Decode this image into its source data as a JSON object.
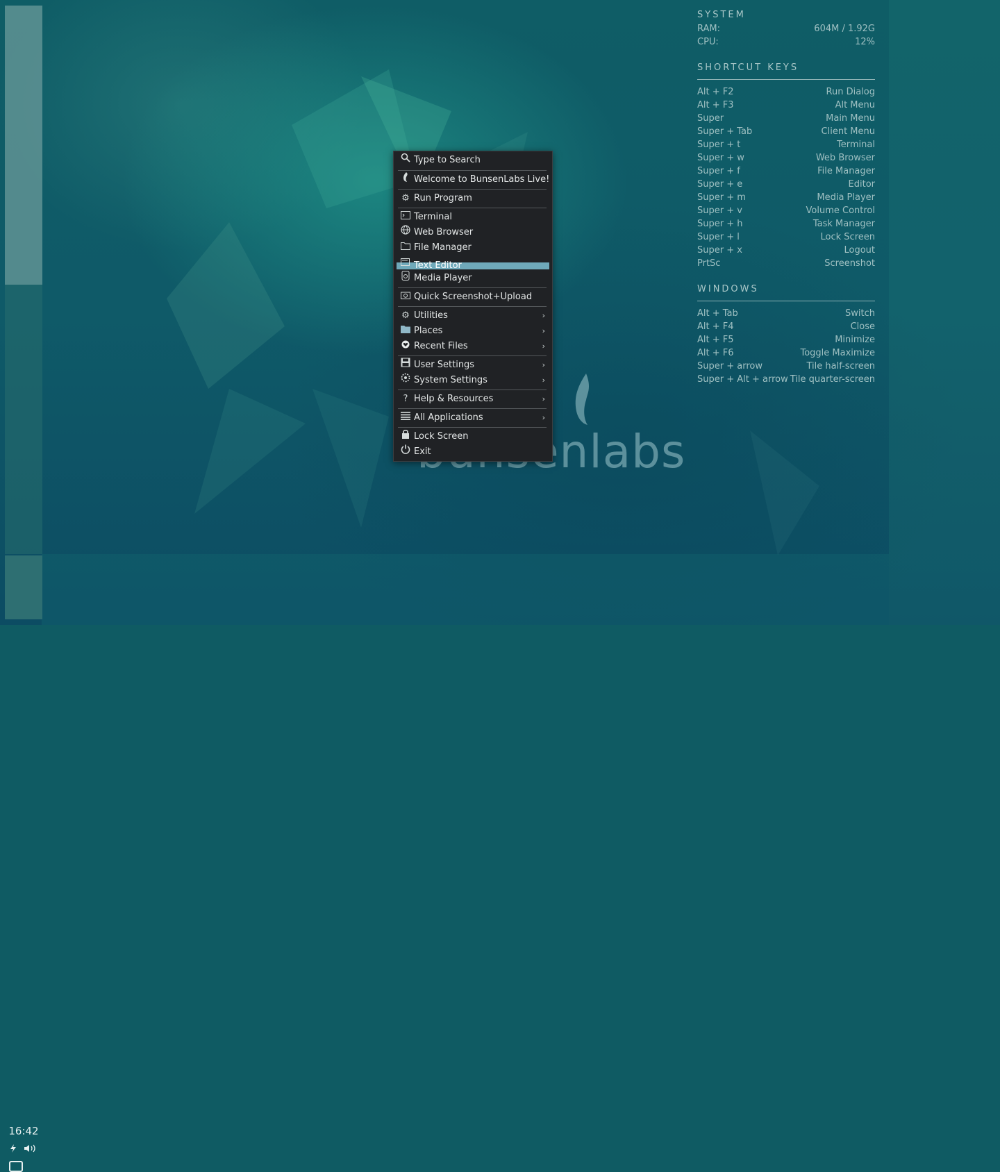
{
  "panel": {
    "clock": "16:42",
    "tray": {
      "power_icon": "power-icon",
      "volume_icon": "volume-icon"
    }
  },
  "logo": {
    "text": "bunsenlabs"
  },
  "conky": {
    "system": {
      "heading": "SYSTEM",
      "rows": [
        {
          "label": "RAM:",
          "value": "604M / 1.92G"
        },
        {
          "label": "CPU:",
          "value": "12%"
        }
      ]
    },
    "shortcuts": {
      "heading": "SHORTCUT KEYS",
      "rows": [
        {
          "key": "Alt + F2",
          "action": "Run Dialog"
        },
        {
          "key": "Alt + F3",
          "action": "Alt Menu"
        },
        {
          "key": "Super",
          "action": "Main Menu"
        },
        {
          "key": "Super + Tab",
          "action": "Client Menu"
        },
        {
          "key": "Super + t",
          "action": "Terminal"
        },
        {
          "key": "Super + w",
          "action": "Web Browser"
        },
        {
          "key": "Super + f",
          "action": "File Manager"
        },
        {
          "key": "Super + e",
          "action": "Editor"
        },
        {
          "key": "Super + m",
          "action": "Media Player"
        },
        {
          "key": "Super + v",
          "action": "Volume Control"
        },
        {
          "key": "Super + h",
          "action": "Task Manager"
        },
        {
          "key": "Super + l",
          "action": "Lock Screen"
        },
        {
          "key": "Super + x",
          "action": "Logout"
        },
        {
          "key": "PrtSc",
          "action": "Screenshot"
        }
      ]
    },
    "windows": {
      "heading": "WINDOWS",
      "rows": [
        {
          "key": "Alt + Tab",
          "action": "Switch"
        },
        {
          "key": "Alt + F4",
          "action": "Close"
        },
        {
          "key": "Alt + F5",
          "action": "Minimize"
        },
        {
          "key": "Alt + F6",
          "action": "Toggle Maximize"
        },
        {
          "key": "Super + arrow",
          "action": "Tile half-screen"
        },
        {
          "key": "Super + Alt + arrow",
          "action": "Tile quarter-screen"
        }
      ]
    }
  },
  "menu": {
    "items": [
      {
        "label": "Type to Search",
        "icon": "search-icon"
      },
      {
        "label": "Welcome to BunsenLabs Live!",
        "icon": "flame-icon"
      },
      {
        "label": "Run Program",
        "icon": "gears-icon"
      },
      {
        "label": "Terminal",
        "icon": "terminal-icon"
      },
      {
        "label": "Web Browser",
        "icon": "globe-icon"
      },
      {
        "label": "File Manager",
        "icon": "folder-icon"
      },
      {
        "label": "Text Editor",
        "icon": "editor-icon"
      },
      {
        "label": "Media Player",
        "icon": "media-icon"
      },
      {
        "label": "Quick Screenshot+Upload",
        "icon": "camera-icon"
      },
      {
        "label": "Utilities",
        "icon": "gears-icon",
        "arrow": "›"
      },
      {
        "label": "Places",
        "icon": "folder-icon",
        "arrow": "›"
      },
      {
        "label": "Recent Files",
        "icon": "heart-icon",
        "arrow": "›"
      },
      {
        "label": "User Settings",
        "icon": "save-icon",
        "arrow": "›"
      },
      {
        "label": "System Settings",
        "icon": "settings-icon",
        "arrow": "›"
      },
      {
        "label": "Help & Resources",
        "icon": "help-icon",
        "arrow": "›"
      },
      {
        "label": "All Applications",
        "icon": "list-icon",
        "arrow": "›"
      },
      {
        "label": "Lock Screen",
        "icon": "lock-icon"
      },
      {
        "label": "Exit",
        "icon": "power-icon"
      }
    ],
    "highlighted": "Text Editor"
  }
}
